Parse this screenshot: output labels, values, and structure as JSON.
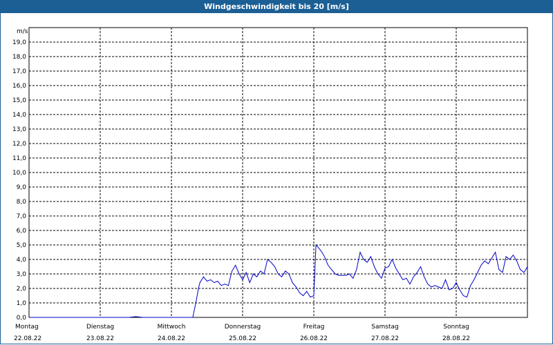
{
  "header": {
    "title": "Windgeschwindigkeit bis 20 [m/s]"
  },
  "colors": {
    "title_bar": "#1c5f95",
    "series": "#0000c8",
    "grid": "#000000"
  },
  "chart_data": {
    "type": "line",
    "title": "Windgeschwindigkeit bis 20 [m/s]",
    "ylabel": "m/s",
    "ylim": [
      0,
      20
    ],
    "yticks": [
      "0,0",
      "1,0",
      "2,0",
      "3,0",
      "4,0",
      "5,0",
      "6,0",
      "7,0",
      "8,0",
      "9,0",
      "10,0",
      "11,0",
      "12,0",
      "13,0",
      "14,0",
      "15,0",
      "16,0",
      "17,0",
      "18,0",
      "19,0"
    ],
    "xlim": [
      0,
      7
    ],
    "x_tick_labels": [
      {
        "day": "Montag",
        "date": "22.08.22"
      },
      {
        "day": "Dienstag",
        "date": "23.08.22"
      },
      {
        "day": "Mittwoch",
        "date": "24.08.22"
      },
      {
        "day": "Donnerstag",
        "date": "25.08.22"
      },
      {
        "day": "Freitag",
        "date": "26.08.22"
      },
      {
        "day": "Samstag",
        "date": "27.08.22"
      },
      {
        "day": "Sonntag",
        "date": "28.08.22"
      }
    ],
    "grid": true,
    "series": [
      {
        "x": [
          0,
          0.2,
          0.4,
          0.6,
          0.8,
          1.0,
          1.2,
          1.4,
          1.5,
          1.6,
          1.8,
          2.0,
          2.2,
          2.3,
          2.35,
          2.38,
          2.4,
          2.45,
          2.5,
          2.55,
          2.6,
          2.65,
          2.7,
          2.75,
          2.8,
          2.85,
          2.9,
          2.95,
          3.0,
          3.05,
          3.1,
          3.15,
          3.2,
          3.25,
          3.3,
          3.35,
          3.4,
          3.45,
          3.5,
          3.55,
          3.6,
          3.65,
          3.7,
          3.75,
          3.8,
          3.85,
          3.9,
          3.95,
          4.0,
          4.03,
          4.05,
          4.1,
          4.15,
          4.2,
          4.25,
          4.3,
          4.35,
          4.4,
          4.45,
          4.5,
          4.55,
          4.6,
          4.65,
          4.7,
          4.75,
          4.8,
          4.85,
          4.9,
          4.95,
          5.0,
          5.05,
          5.1,
          5.15,
          5.2,
          5.25,
          5.3,
          5.35,
          5.4,
          5.45,
          5.5,
          5.55,
          5.6,
          5.65,
          5.7,
          5.75,
          5.8,
          5.85,
          5.9,
          5.95,
          6.0,
          6.05,
          6.1,
          6.15,
          6.2,
          6.25,
          6.3,
          6.35,
          6.4,
          6.45,
          6.5,
          6.55,
          6.6,
          6.65,
          6.7,
          6.75,
          6.8,
          6.85,
          6.9,
          6.95,
          7.0
        ],
        "y": [
          0,
          0,
          0,
          0,
          0,
          0,
          0,
          0,
          0.05,
          0,
          0,
          0,
          0,
          0,
          1.2,
          2.0,
          2.4,
          2.8,
          2.5,
          2.6,
          2.4,
          2.5,
          2.2,
          2.3,
          2.2,
          3.2,
          3.6,
          3.0,
          2.6,
          3.1,
          2.4,
          3.0,
          2.8,
          3.2,
          3.0,
          4.0,
          3.8,
          3.5,
          3.0,
          2.8,
          3.2,
          3.0,
          2.4,
          2.1,
          1.7,
          1.5,
          1.8,
          1.4,
          1.5,
          5.0,
          4.9,
          4.6,
          4.2,
          3.6,
          3.3,
          3.0,
          2.9,
          2.9,
          2.9,
          3.0,
          2.7,
          3.3,
          4.5,
          4.0,
          3.8,
          4.2,
          3.5,
          3.0,
          2.7,
          3.4,
          3.5,
          4.0,
          3.4,
          3.0,
          2.6,
          2.7,
          2.3,
          2.8,
          3.1,
          3.5,
          2.8,
          2.3,
          2.1,
          2.2,
          2.1,
          2.0,
          2.6,
          1.9,
          2.0,
          2.4,
          1.9,
          1.5,
          1.4,
          2.2,
          2.6,
          3.1,
          3.6,
          3.9,
          3.7,
          4.1,
          4.5,
          3.3,
          3.1,
          4.2,
          4.0,
          4.3,
          3.9,
          3.3,
          3.1,
          3.5
        ]
      }
    ]
  }
}
